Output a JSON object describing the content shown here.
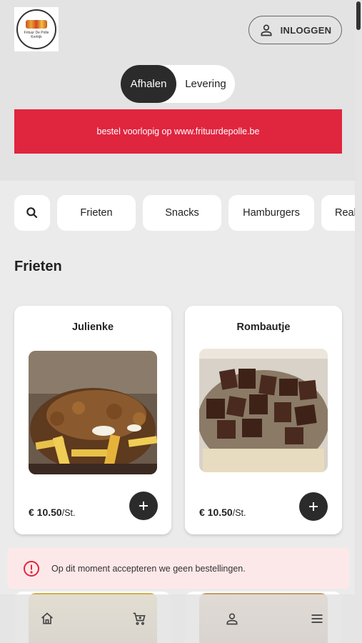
{
  "header": {
    "logo_text": "Frituur De Polle",
    "logo_subtext": "Kortrijk",
    "login_label": "INLOGGEN"
  },
  "mode_toggle": {
    "options": [
      "Afhalen",
      "Levering"
    ],
    "selected": "Afhalen"
  },
  "banner": {
    "text": "bestel voorlopig op www.frituurdepolle.be",
    "color": "#e0253f"
  },
  "categories": {
    "search_icon": "search-icon",
    "items": [
      "Frieten",
      "Snacks",
      "Hamburgers",
      "Real"
    ]
  },
  "section": {
    "title": "Frieten"
  },
  "products": [
    {
      "name": "Julienke",
      "price": "€ 10.50",
      "unit": "/St."
    },
    {
      "name": "Rombautje",
      "price": "€ 10.50",
      "unit": "/St."
    }
  ],
  "alert": {
    "text": "Op dit moment accepteren we geen bestellingen.",
    "icon": "error-circle-icon",
    "color": "#e0253f"
  },
  "bottom_nav": {
    "icons": [
      "home-icon",
      "cart-icon",
      "user-icon",
      "menu-icon"
    ]
  },
  "colors": {
    "dark": "#2b2b2b",
    "accent": "#e0253f",
    "background": "#ebebeb"
  }
}
